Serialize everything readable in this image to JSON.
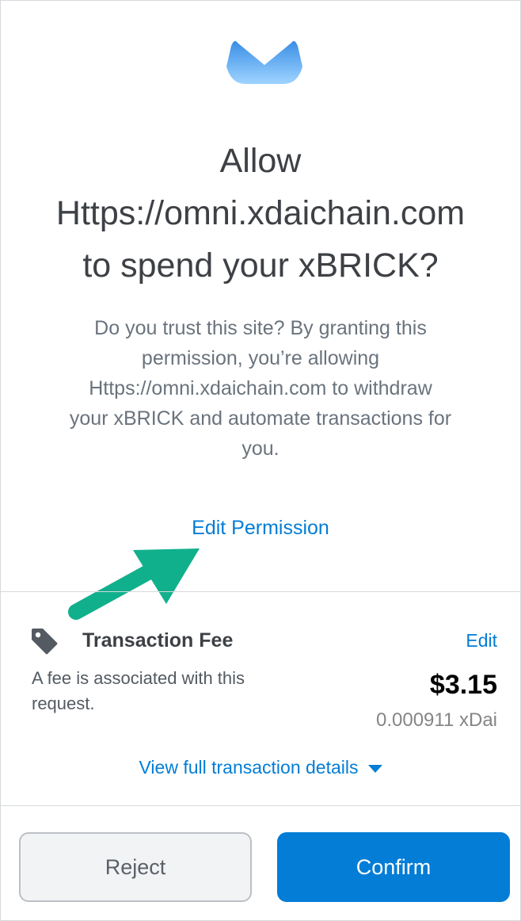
{
  "header": {
    "logo_icon": "site-fox-logo-icon",
    "title_line1": "Allow",
    "title_line2": "Https://omni.xdaichain.com",
    "title_line3": "to spend your xBRICK?"
  },
  "description": {
    "line1": "Do you trust this site? By granting this",
    "line2": "permission, you’re allowing",
    "line3": "Https://omni.xdaichain.com to withdraw",
    "line4": "your xBRICK and automate transactions for",
    "line5": "you."
  },
  "edit_permission_label": "Edit Permission",
  "annotation_icon": "green-arrow-icon",
  "fee": {
    "icon": "tag-icon",
    "title": "Transaction Fee",
    "edit_label": "Edit",
    "description_line1": "A fee is associated with this",
    "description_line2": "request.",
    "usd": "$3.15",
    "native": "0.000911 xDai"
  },
  "details_link_label": "View full transaction details",
  "actions": {
    "reject_label": "Reject",
    "confirm_label": "Confirm"
  },
  "colors": {
    "accent": "#037dd6",
    "arrow": "#11b08c",
    "text_dark": "#3d4045",
    "text_muted": "#6a737d"
  }
}
